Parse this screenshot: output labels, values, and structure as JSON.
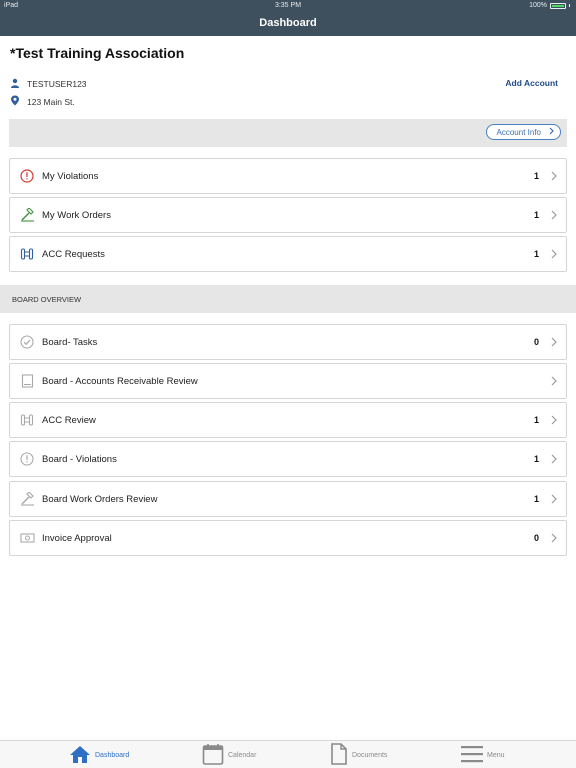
{
  "status_bar": {
    "device": "iPad",
    "time": "3:35 PM",
    "battery": "100%"
  },
  "nav": {
    "title": "Dashboard"
  },
  "account": {
    "name": "*Test Training Association",
    "user": "TESTUSER123",
    "address": "123 Main St.",
    "add_account": "Add Account",
    "account_info": "Account Info"
  },
  "my_items": [
    {
      "label": "My Violations",
      "count": "1",
      "icon": "alert-circle-icon"
    },
    {
      "label": "My Work Orders",
      "count": "1",
      "icon": "hammer-icon"
    },
    {
      "label": "ACC Requests",
      "count": "1",
      "icon": "acc-icon"
    }
  ],
  "board_section": {
    "title": "BOARD OVERVIEW"
  },
  "board_items": [
    {
      "label": "Board- Tasks",
      "count": "0",
      "icon": "check-circle-icon"
    },
    {
      "label": "Board - Accounts Receivable Review",
      "count": "",
      "icon": "ledger-icon"
    },
    {
      "label": "ACC Review",
      "count": "1",
      "icon": "acc-icon"
    },
    {
      "label": "Board - Violations",
      "count": "1",
      "icon": "alert-circle-icon"
    },
    {
      "label": "Board Work Orders Review",
      "count": "1",
      "icon": "hammer-icon"
    },
    {
      "label": "Invoice Approval",
      "count": "0",
      "icon": "money-icon"
    }
  ],
  "tabs": [
    {
      "label": "Dashboard",
      "icon": "home-icon",
      "active": true
    },
    {
      "label": "Calendar",
      "icon": "calendar-icon",
      "active": false
    },
    {
      "label": "Documents",
      "icon": "document-icon",
      "active": false
    },
    {
      "label": "Menu",
      "icon": "hamburger-icon",
      "active": false
    }
  ],
  "colors": {
    "nav_bg": "#3e4f5d",
    "link_blue": "#1f4a8a",
    "accent_blue": "#2e6fc4",
    "violation_red": "#d33a2c",
    "work_order_green": "#3f8f3f",
    "acc_blue": "#2f5f9e",
    "board_icon_gray": "#a8a8a8"
  }
}
